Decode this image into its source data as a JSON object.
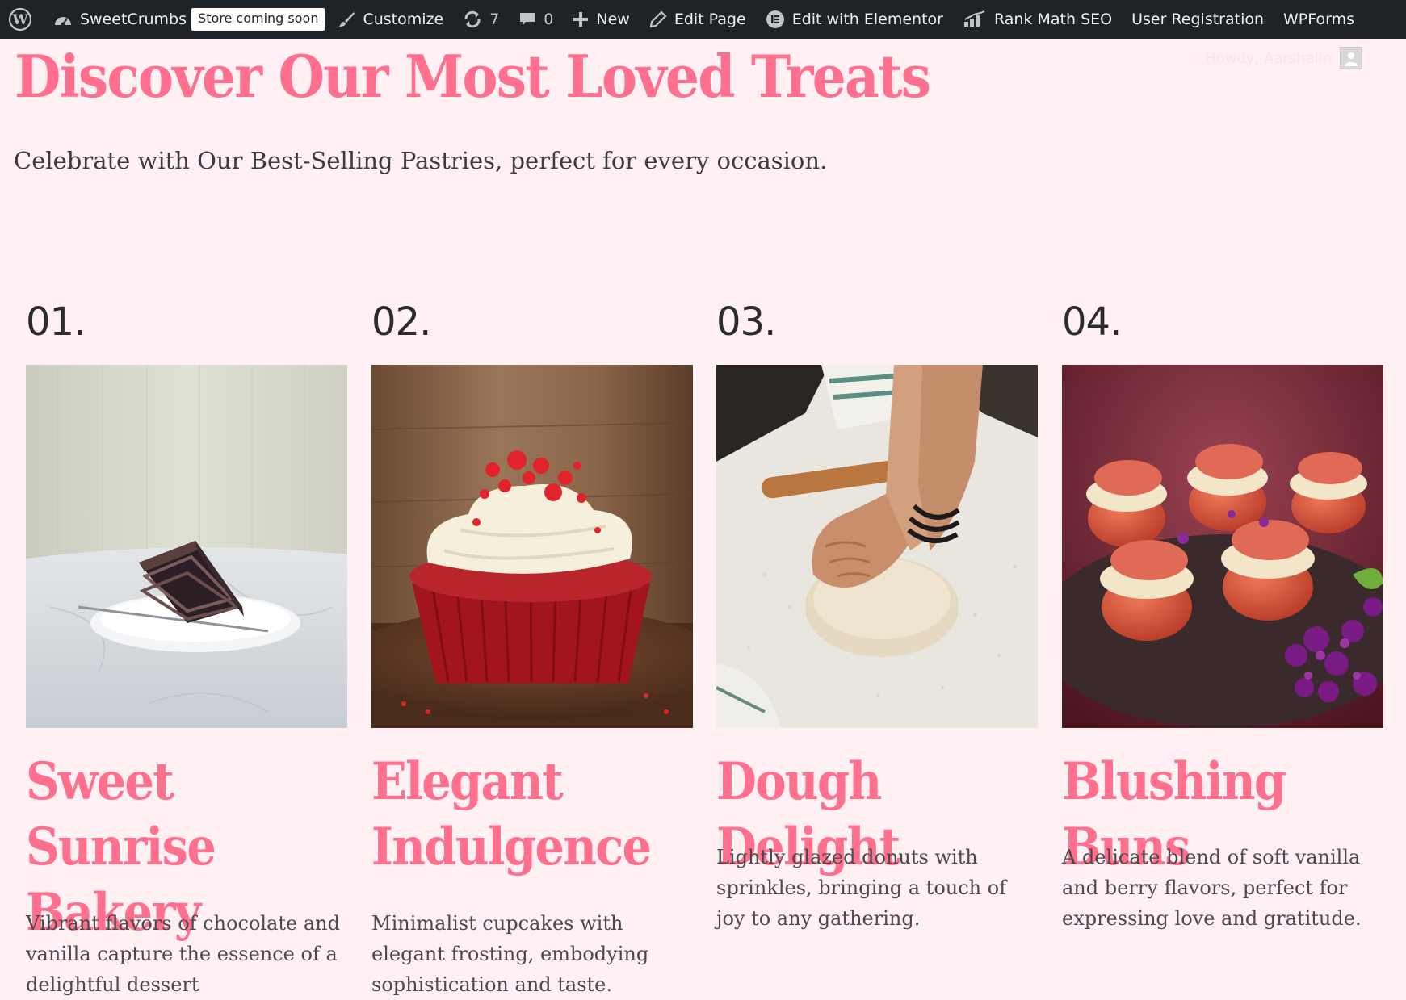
{
  "adminbar": {
    "site_name": "SweetCrumbs",
    "store_badge": "Store coming soon",
    "customize": "Customize",
    "updates_count": "7",
    "comments_count": "0",
    "new": "New",
    "edit_page": "Edit Page",
    "edit_elementor": "Edit with Elementor",
    "rank_math": "Rank Math SEO",
    "user_registration": "User Registration",
    "wpforms": "WPForms",
    "howdy": "Howdy, Aarshalin"
  },
  "header": {
    "title": "Discover Our Most Loved Treats",
    "subtitle": "Celebrate with Our Best-Selling Pastries, perfect for every occasion."
  },
  "cards": [
    {
      "number": "01.",
      "title": "Sweet Sunrise Bakery",
      "description": "Vibrant flavors of chocolate and vanilla capture the essence of a delightful dessert"
    },
    {
      "number": "02.",
      "title": "Elegant Indulgence",
      "description": "Minimalist cupcakes with elegant frosting, embodying sophistication and taste."
    },
    {
      "number": "03.",
      "title": "Dough Delight",
      "description": "Lightly glazed donuts with sprinkles, bringing a touch of joy to any gathering."
    },
    {
      "number": "04.",
      "title": "Blushing Buns",
      "description": "A delicate blend of soft vanilla and berry flavors, perfect for expressing love and gratitude."
    }
  ],
  "colors": {
    "accent": "#ff6f8e",
    "background": "#fff0f3",
    "adminbar": "#1d2327"
  }
}
